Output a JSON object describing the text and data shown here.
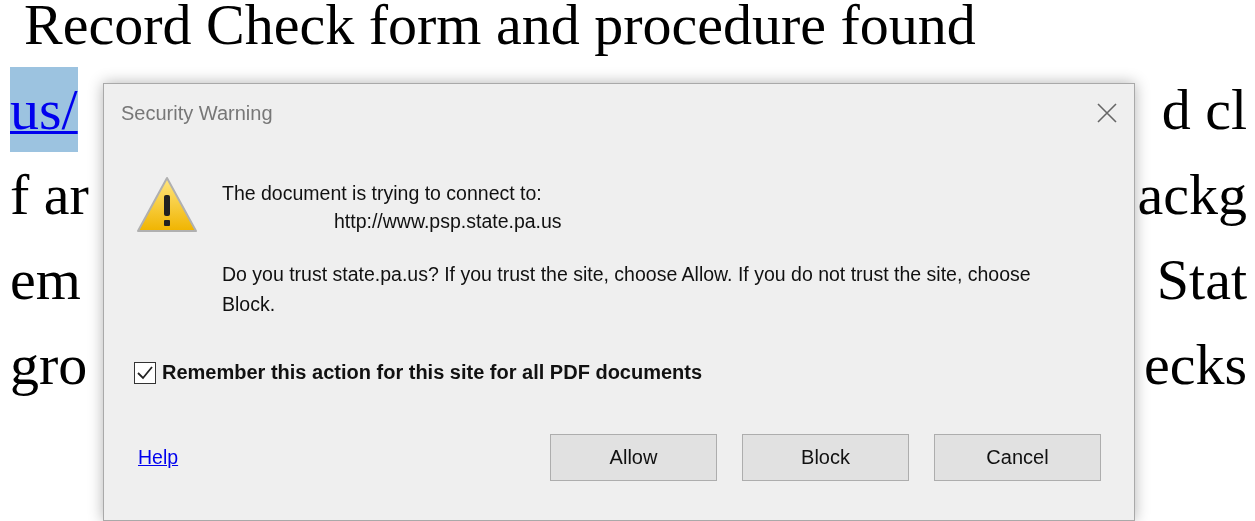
{
  "document": {
    "lines": [
      {
        "fragments": [
          {
            "text": "Record Check form and procedure found",
            "kind": "text",
            "selected": false
          }
        ]
      },
      {
        "fragments": [
          {
            "text": "us/",
            "kind": "link",
            "selected": true
          },
          {
            "text": "d cl",
            "kind": "text",
            "selected": false
          }
        ]
      },
      {
        "fragments": [
          {
            "text": "f ar",
            "kind": "text",
            "selected": false
          },
          {
            "text": "ackg",
            "kind": "text",
            "selected": false
          }
        ]
      },
      {
        "fragments": [
          {
            "text": "em",
            "kind": "text",
            "selected": false
          },
          {
            "text": "Stat",
            "kind": "text",
            "selected": false
          }
        ]
      },
      {
        "fragments": [
          {
            "text": "gro",
            "kind": "text",
            "selected": false
          },
          {
            "text": "ecks",
            "kind": "text",
            "selected": false
          }
        ]
      }
    ]
  },
  "dialog": {
    "title": "Security Warning",
    "message": "The document is trying to connect to:",
    "url": "http://www.psp.state.pa.us",
    "question": "Do you trust state.pa.us? If you trust the site, choose Allow. If you do not trust the site, choose Block.",
    "remember": {
      "label": "Remember this action for this site for all PDF documents",
      "checked": true
    },
    "help_link": "Help",
    "buttons": [
      "Allow",
      "Block",
      "Cancel"
    ]
  }
}
